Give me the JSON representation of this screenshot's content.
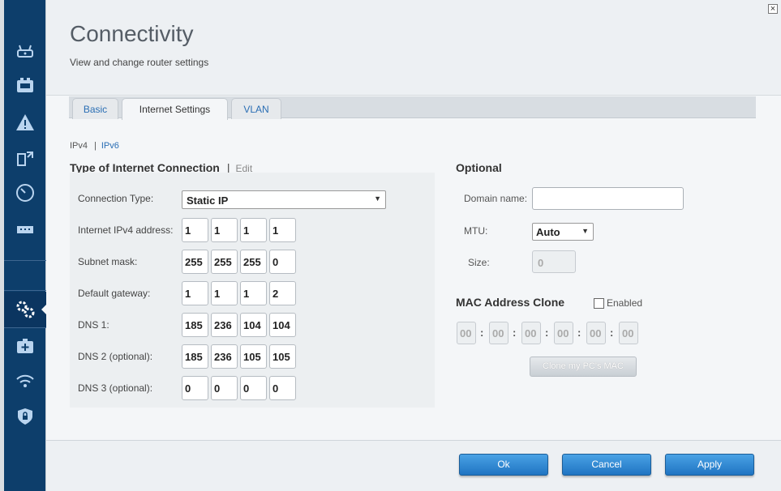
{
  "header": {
    "title": "Connectivity",
    "subtitle": "View and change router settings",
    "close_glyph": "×"
  },
  "sidebar": {
    "items": [
      {
        "icon": "router-icon"
      },
      {
        "icon": "network-map-icon"
      },
      {
        "icon": "troubleshooting-icon"
      },
      {
        "icon": "media-prioritization-icon"
      },
      {
        "icon": "speed-test-icon"
      },
      {
        "icon": "usb-storage-icon"
      },
      {
        "icon": "connectivity-gear-icon",
        "active": true
      },
      {
        "icon": "troubleshooting-kit-icon"
      },
      {
        "icon": "wireless-icon"
      },
      {
        "icon": "security-shield-icon"
      }
    ]
  },
  "tabs": [
    {
      "label": "Basic",
      "active": false
    },
    {
      "label": "Internet Settings",
      "active": true
    },
    {
      "label": "VLAN",
      "active": false
    }
  ],
  "ip_links": {
    "ipv4": "IPv4",
    "sep": "|",
    "ipv6": "IPv6"
  },
  "connection": {
    "title": "Type of Internet Connection",
    "sep": "|",
    "edit_label": "Edit",
    "type_label": "Connection Type:",
    "type_value": "Static IP",
    "fields": [
      {
        "label": "Internet IPv4 address:",
        "octets": [
          "1",
          "1",
          "1",
          "1"
        ]
      },
      {
        "label": "Subnet mask:",
        "octets": [
          "255",
          "255",
          "255",
          "0"
        ]
      },
      {
        "label": "Default gateway:",
        "octets": [
          "1",
          "1",
          "1",
          "2"
        ]
      },
      {
        "label": "DNS 1:",
        "octets": [
          "185",
          "236",
          "104",
          "104"
        ]
      },
      {
        "label": "DNS 2 (optional):",
        "octets": [
          "185",
          "236",
          "105",
          "105"
        ]
      },
      {
        "label": "DNS 3 (optional):",
        "octets": [
          "0",
          "0",
          "0",
          "0"
        ]
      }
    ]
  },
  "optional": {
    "title": "Optional",
    "domain_label": "Domain name:",
    "domain_value": "",
    "mtu_label": "MTU:",
    "mtu_value": "Auto",
    "size_label": "Size:",
    "size_value": "0"
  },
  "mac_clone": {
    "title": "MAC Address Clone",
    "enabled_label": "Enabled",
    "enabled": false,
    "octets": [
      "00",
      "00",
      "00",
      "00",
      "00",
      "00"
    ],
    "clone_button": "Clone my PC's MAC"
  },
  "footer": {
    "ok": "Ok",
    "cancel": "Cancel",
    "apply": "Apply"
  },
  "colors": {
    "sidebar_bg": "#0d3e6b",
    "link_blue": "#2a6eb4",
    "button_blue": "#1f74c2"
  }
}
